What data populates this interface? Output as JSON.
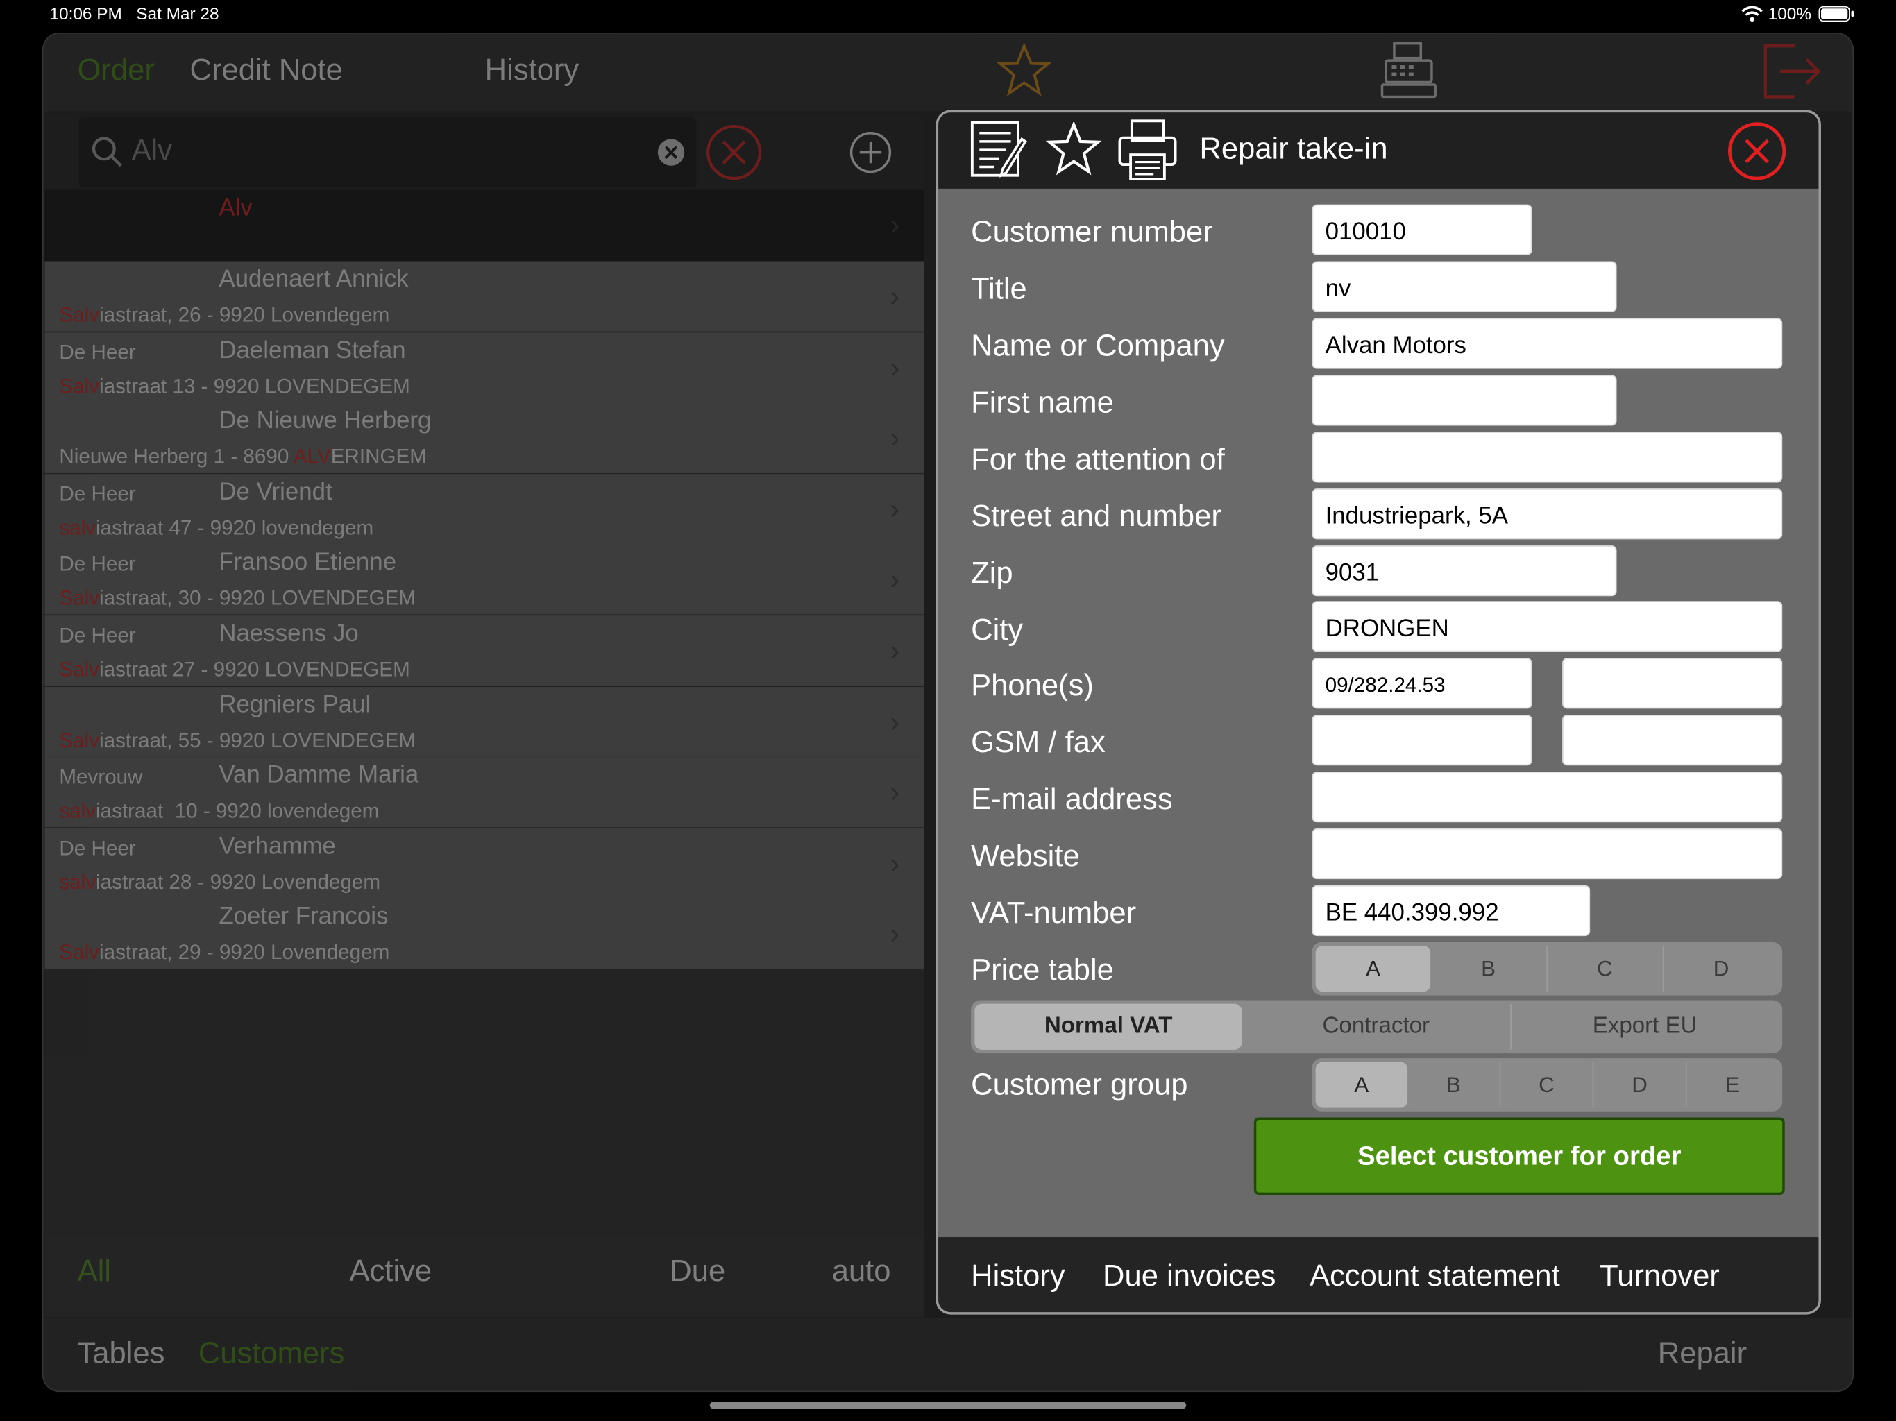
{
  "status_bar": {
    "time": "10:06 PM",
    "date": "Sat Mar 28",
    "battery": "100%",
    "wifi_icon": "wifi-icon"
  },
  "top_tabs": {
    "order": "Order",
    "credit_note": "Credit Note",
    "history": "History"
  },
  "top_icons": [
    "star-icon",
    "cash-register-icon",
    "logout-icon"
  ],
  "search": {
    "value": "Alv",
    "clear_icon": "clear-icon",
    "cancel_icon": "cancel-circle-icon",
    "add_icon": "add-circle-icon"
  },
  "customers": [
    {
      "salutation": "",
      "name": "Audenaert Annick",
      "addr_pre": "",
      "addr_hl": "Salv",
      "addr_post": "iastraat, 26 - 9920 Lovendegem"
    },
    {
      "salutation": "De Heer",
      "name": "Daeleman Stefan",
      "addr_pre": "",
      "addr_hl": "Salv",
      "addr_post": "iastraat 13 - 9920 LOVENDEGEM"
    },
    {
      "salutation": "",
      "name": "De Nieuwe Herberg",
      "addr_pre": "Nieuwe Herberg 1 - 8690 ",
      "addr_hl": "ALV",
      "addr_post": "ERINGEM"
    },
    {
      "salutation": "De Heer",
      "name": "De Vriendt",
      "addr_pre": "",
      "addr_hl": "salv",
      "addr_post": "iastraat 47 - 9920 lovendegem"
    },
    {
      "salutation": "De Heer",
      "name": "Fransoo Etienne",
      "addr_pre": "",
      "addr_hl": "Salv",
      "addr_post": "iastraat, 30 - 9920 LOVENDEGEM"
    },
    {
      "salutation": "De Heer",
      "name": "Naessens Jo",
      "addr_pre": "",
      "addr_hl": "Salv",
      "addr_post": "iastraat 27 - 9920 LOVENDEGEM"
    },
    {
      "salutation": "",
      "name": "Regniers Paul",
      "addr_pre": "",
      "addr_hl": "Salv",
      "addr_post": "iastraat, 55 - 9920 LOVENDEGEM"
    },
    {
      "salutation": "Mevrouw",
      "name": "Van Damme Maria",
      "addr_pre": "",
      "addr_hl": "salv",
      "addr_post": "iastraat  10 - 9920 lovendegem"
    },
    {
      "salutation": "De Heer",
      "name": "Verhamme",
      "addr_pre": "",
      "addr_hl": "salv",
      "addr_post": "iastraat 28 - 9920 Lovendegem"
    },
    {
      "salutation": "",
      "name": "Zoeter Francois",
      "addr_pre": "",
      "addr_hl": "Salv",
      "addr_post": "iastraat, 29 - 9920 Lovendegem"
    }
  ],
  "filters": {
    "all": "All",
    "active": "Active",
    "due": "Due",
    "auto": "auto"
  },
  "bottom_tabs": {
    "tables": "Tables",
    "customers": "Customers",
    "repair": "Repair"
  },
  "dialog": {
    "title": "Repair take-in",
    "icons": [
      "notes-icon",
      "star-icon",
      "printer-icon",
      "close-icon"
    ],
    "labels": {
      "customer_number": "Customer number",
      "title": "Title",
      "name": "Name or Company",
      "first_name": "First name",
      "attention": "For the attention of",
      "street": "Street and number",
      "zip": "Zip",
      "city": "City",
      "phones": "Phone(s)",
      "gsm": "GSM / fax",
      "email": "E-mail address",
      "website": "Website",
      "vat": "VAT-number",
      "price_table": "Price table",
      "customer_group": "Customer group"
    },
    "values": {
      "customer_number": "010010",
      "title": "nv",
      "name": "Alvan Motors",
      "first_name": "",
      "attention": "",
      "street": "Industriepark, 5A",
      "zip": "9031",
      "city": "DRONGEN",
      "phone1": "09/282.24.53",
      "phone2": "",
      "gsm1": "",
      "gsm2": "",
      "email": "",
      "website": "",
      "vat": "BE 440.399.992"
    },
    "price_table": {
      "options": [
        "A",
        "B",
        "C",
        "D"
      ],
      "selected": "A"
    },
    "vat_type": {
      "options": [
        "Normal VAT",
        "Contractor",
        "Export EU"
      ],
      "selected": "Normal VAT"
    },
    "customer_group": {
      "options": [
        "A",
        "B",
        "C",
        "D",
        "E"
      ],
      "selected": "A"
    },
    "select_button": "Select customer for order",
    "footer": {
      "history": "History",
      "due_invoices": "Due invoices",
      "account_statement": "Account statement",
      "turnover": "Turnover"
    }
  },
  "colors": {
    "accent_green": "#4c8f16",
    "button_green": "#4e9212",
    "alert_red": "#e02020"
  }
}
